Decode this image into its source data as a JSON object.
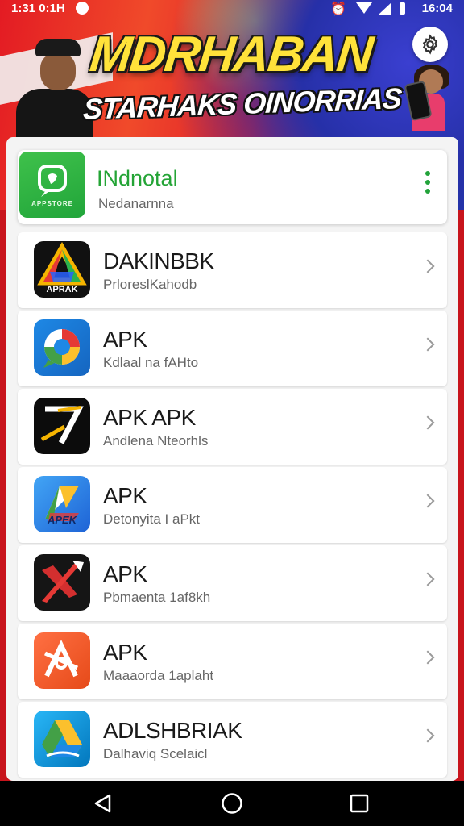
{
  "status_bar": {
    "time_left": "1:31 0:1H",
    "time_right": "16:04"
  },
  "banner": {
    "title": "MDRHABAN",
    "subtitle": "STARHAKS OINORRIAS"
  },
  "header": {
    "title": "INdnotal",
    "subtitle": "Nedanarnna",
    "icon_tag": "APPSTORE"
  },
  "apps": [
    {
      "title": "DAKINBBK",
      "subtitle": "PrloreslKahodb",
      "icon": "triangle-logo-icon",
      "icon_label": "APRAK"
    },
    {
      "title": "APK",
      "subtitle": "Kdlaal na fAHto",
      "icon": "chat-bubble-icon",
      "icon_label": ""
    },
    {
      "title": "APK APK",
      "subtitle": "Andlena Nteorhls",
      "icon": "arrow-logo-icon",
      "icon_label": ""
    },
    {
      "title": "APK",
      "subtitle": "Detonyita I aPkt",
      "icon": "folded-a-icon",
      "icon_label": "APEK"
    },
    {
      "title": "APK",
      "subtitle": "Pbmaenta 1af8kh",
      "icon": "cross-arrow-icon",
      "icon_label": ""
    },
    {
      "title": "APK",
      "subtitle": "Maaaorda 1aplaht",
      "icon": "abstract-a-icon",
      "icon_label": ""
    },
    {
      "title": "ADLSHBRIAK",
      "subtitle": "Dalhaviq Scelaicl",
      "icon": "drive-triangle-icon",
      "icon_label": ""
    }
  ],
  "colors": {
    "accent_green": "#22a33a",
    "banner_red": "#e31b23",
    "banner_blue": "#2630a8"
  }
}
